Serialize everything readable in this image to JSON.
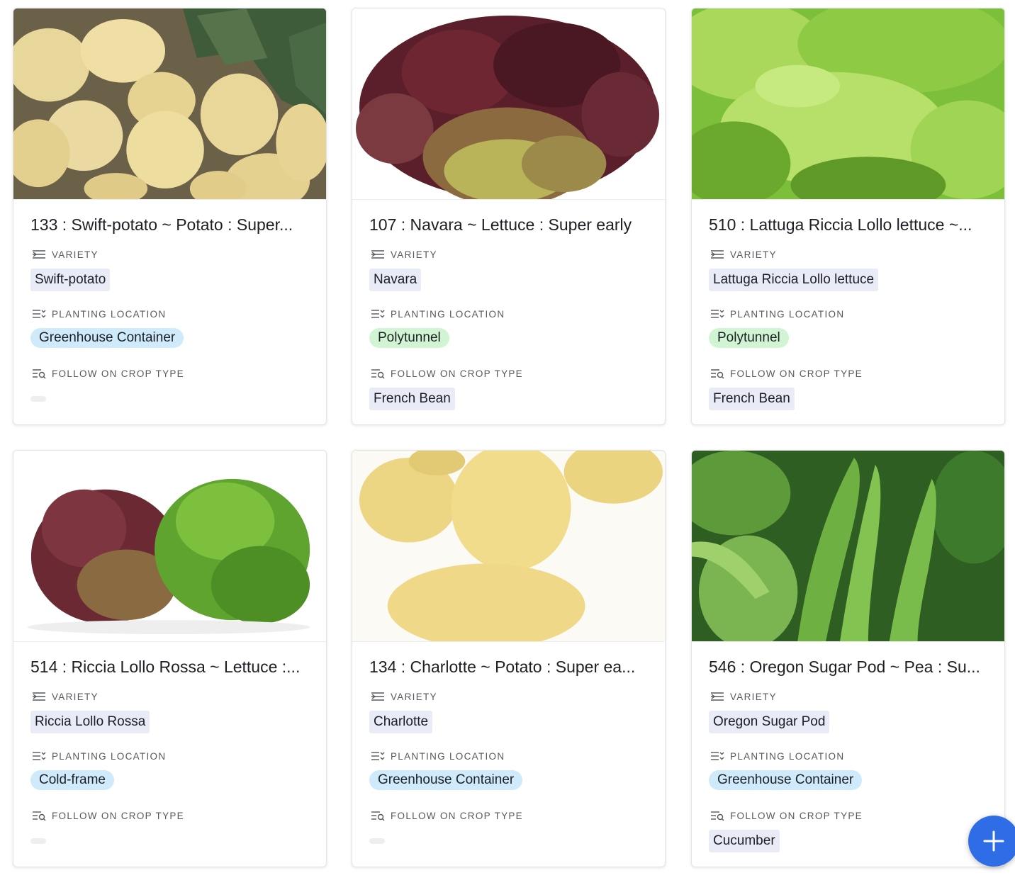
{
  "cards": [
    {
      "title": "133 : Swift-potato ~ Potato : Super...",
      "variety_label": "VARIETY",
      "variety": "Swift-potato",
      "location_label": "PLANTING LOCATION",
      "location": "Greenhouse Container",
      "location_color": "#cfeafb",
      "followon_label": "FOLLOW ON CROP TYPE",
      "followon": "",
      "image": "potato-photo"
    },
    {
      "title": "107 : Navara ~ Lettuce : Super early",
      "variety_label": "VARIETY",
      "variety": "Navara",
      "location_label": "PLANTING LOCATION",
      "location": "Polytunnel",
      "location_color": "#d1f5d3",
      "followon_label": "FOLLOW ON CROP TYPE",
      "followon": "French Bean",
      "image": "red-lettuce-photo"
    },
    {
      "title": "510 : Lattuga Riccia Lollo lettuce ~...",
      "variety_label": "VARIETY",
      "variety": "Lattuga Riccia Lollo lettuce",
      "location_label": "PLANTING LOCATION",
      "location": "Polytunnel",
      "location_color": "#d1f5d3",
      "followon_label": "FOLLOW ON CROP TYPE",
      "followon": "French Bean",
      "image": "green-lettuce-photo"
    },
    {
      "title": "514 : Riccia Lollo Rossa ~ Lettuce :...",
      "variety_label": "VARIETY",
      "variety": "Riccia Lollo Rossa",
      "location_label": "PLANTING LOCATION",
      "location": "Cold-frame",
      "location_color": "#cfeafb",
      "followon_label": "FOLLOW ON CROP TYPE",
      "followon": "",
      "image": "lollo-rossa-photo"
    },
    {
      "title": "134 : Charlotte ~ Potato : Super ea...",
      "variety_label": "VARIETY",
      "variety": "Charlotte",
      "location_label": "PLANTING LOCATION",
      "location": "Greenhouse Container",
      "location_color": "#cfeafb",
      "followon_label": "FOLLOW ON CROP TYPE",
      "followon": "",
      "image": "charlotte-potato-photo"
    },
    {
      "title": "546 : Oregon Sugar Pod ~ Pea : Su...",
      "variety_label": "VARIETY",
      "variety": "Oregon Sugar Pod",
      "location_label": "PLANTING LOCATION",
      "location": "Greenhouse Container",
      "location_color": "#cfeafb",
      "followon_label": "FOLLOW ON CROP TYPE",
      "followon": "Cucumber",
      "image": "pea-pod-photo"
    }
  ],
  "fab": {
    "icon": "plus-icon",
    "color": "#2f6de6"
  }
}
